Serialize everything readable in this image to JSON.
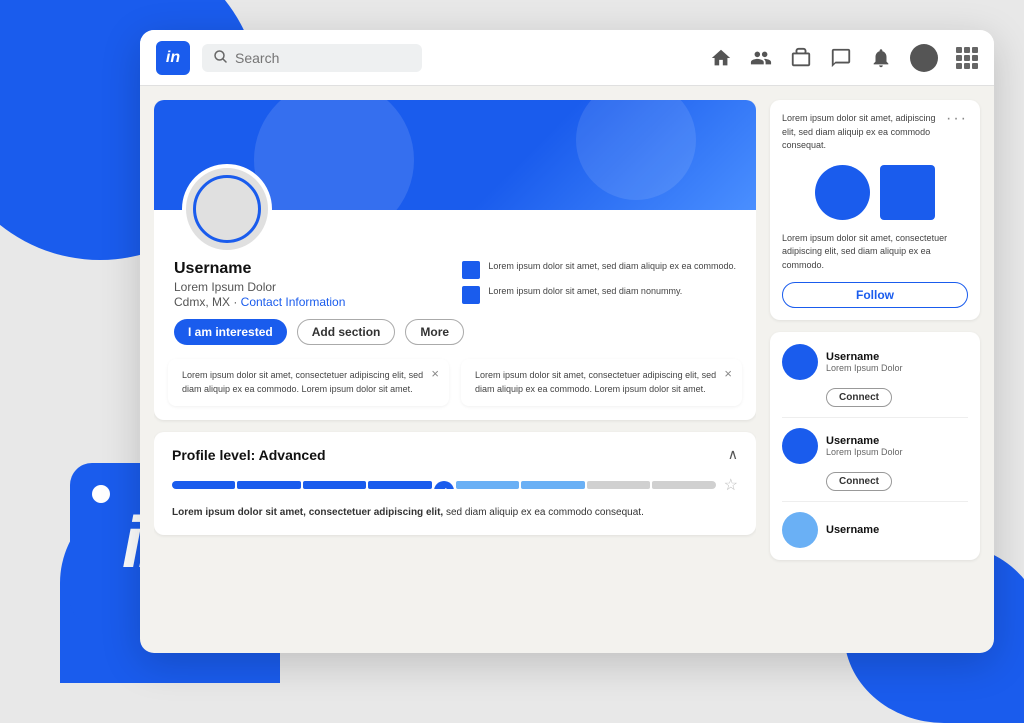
{
  "background": {
    "color": "#e8e8e8",
    "accent": "#1a5ced"
  },
  "nav": {
    "logo_text": "in",
    "search_placeholder": "Search",
    "icons": [
      "home",
      "people",
      "briefcase",
      "messaging",
      "notifications",
      "avatar",
      "grid"
    ]
  },
  "profile": {
    "username": "Username",
    "subtitle": "Lorem Ipsum Dolor",
    "location_prefix": "Cdmx, MX · ",
    "location_link": "Contact Information",
    "side_text_1": "Lorem ipsum dolor sit amet, sed diam aliquip ex ea commodo.",
    "side_text_2": "Lorem ipsum dolor sit amet, sed diam nonummy.",
    "btn_interested": "I am interested",
    "btn_add_section": "Add section",
    "btn_more": "More"
  },
  "notifications": {
    "card1": {
      "text": "Lorem ipsum dolor sit amet, consectetuer adipiscing elit, sed diam aliquip ex ea commodo. Lorem ipsum dolor sit amet."
    },
    "card2": {
      "text": "Lorem ipsum dolor sit amet, consectetuer adipiscing elit, sed diam aliquip ex ea commodo. Lorem ipsum dolor sit amet."
    }
  },
  "level_card": {
    "title": "Profile level: ",
    "level": "Advanced",
    "description_bold": "Lorem ipsum dolor sit amet, consectetuer adipiscing elit,",
    "description_rest": " sed diam aliquip ex ea commodo consequat.",
    "segments": [
      4,
      1,
      2
    ]
  },
  "promo": {
    "dots": "···",
    "text_top": "Lorem ipsum dolor sit amet, adipiscing elit, sed diam aliquip ex ea commodo consequat.",
    "text_bottom": "Lorem ipsum dolor sit amet, consectetuer adipiscing elit, sed diam aliquip ex ea commodo.",
    "btn_follow": "Follow"
  },
  "people": [
    {
      "name": "Username",
      "subtitle": "Lorem Ipsum Dolor",
      "btn": "Connect",
      "avatar_index": 1
    },
    {
      "name": "Username",
      "subtitle": "Lorem Ipsum Dolor",
      "btn": "Connect",
      "avatar_index": 2
    },
    {
      "name": "Username",
      "subtitle": "",
      "btn": "",
      "avatar_index": 3
    }
  ],
  "linkedin_big": {
    "in_text": "in",
    "dot": ""
  }
}
